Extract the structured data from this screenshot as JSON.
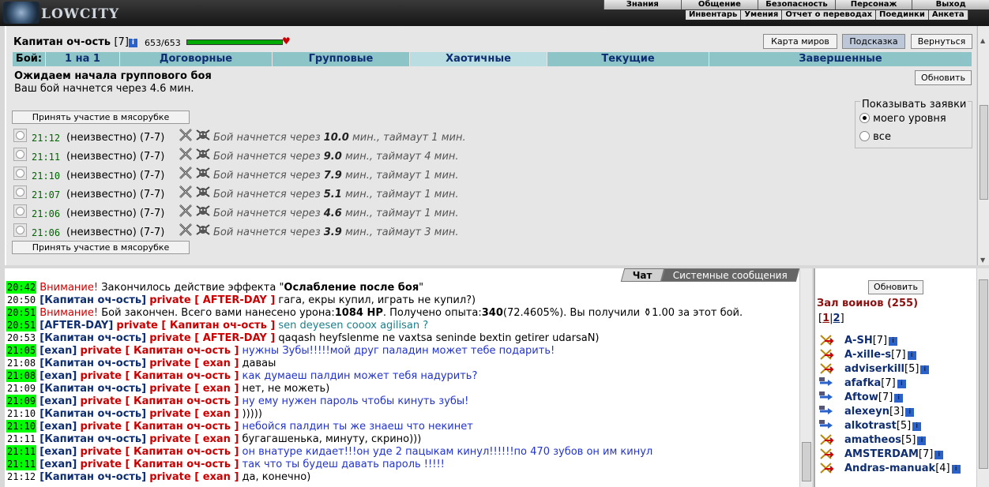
{
  "app": {
    "logo_text": "LOWCITY"
  },
  "topmenu": {
    "row1": [
      "Знания",
      "Общение",
      "Безопасность",
      "Персонаж",
      "Выход"
    ],
    "row2": [
      "Инвентарь",
      "Умения",
      "Отчет о переводах",
      "Поединки",
      "Анкета"
    ]
  },
  "player": {
    "name": "Капитан оч-ость",
    "level": "[7]",
    "hp": "653/653",
    "hp_fraction": 1.0
  },
  "header_buttons": {
    "world_map": "Карта миров",
    "hint": "Подсказка",
    "back": "Вернуться"
  },
  "tabs": {
    "label": "Бой:",
    "items": [
      "1 на 1",
      "Договорные",
      "Групповые",
      "Хаотичные",
      "Текущие",
      "Завершенные"
    ],
    "active": "Хаотичные"
  },
  "status": {
    "title": "Ожидаем начала группового боя",
    "subtitle": "Ваш бой начнется через 4.6 мин.",
    "refresh": "Обновить"
  },
  "show_filter": {
    "label": "Показывать заявки",
    "options": [
      "моего уровня",
      "все"
    ],
    "selected": "моего уровня"
  },
  "join_button": "Принять участие в мясорубке",
  "bids": [
    {
      "time": "21:12",
      "who": "(неизвестно) (7-7)",
      "pre": "Бой начнется через",
      "mins": "10.0",
      "post": "мин., таймаут 1 мин."
    },
    {
      "time": "21:11",
      "who": "(неизвестно) (7-7)",
      "pre": "Бой начнется через",
      "mins": "9.0",
      "post": "мин., таймаут 4 мин."
    },
    {
      "time": "21:10",
      "who": "(неизвестно) (7-7)",
      "pre": "Бой начнется через",
      "mins": "7.9",
      "post": "мин., таймаут 1 мин."
    },
    {
      "time": "21:07",
      "who": "(неизвестно) (7-7)",
      "pre": "Бой начнется через",
      "mins": "5.1",
      "post": "мин., таймаут 1 мин."
    },
    {
      "time": "21:06",
      "who": "(неизвестно) (7-7)",
      "pre": "Бой начнется через",
      "mins": "4.6",
      "post": "мин., таймаут 1 мин."
    },
    {
      "time": "21:06",
      "who": "(неизвестно) (7-7)",
      "pre": "Бой начнется через",
      "mins": "3.9",
      "post": "мин., таймаут 3 мин."
    }
  ],
  "chat_tabs": [
    "Чат",
    "Системные сообщения"
  ],
  "chat": [
    {
      "t": "20:42",
      "hl": true,
      "parts": [
        [
          "warn",
          "Внимание!"
        ],
        [
          "",
          "Закончилось действие эффекта \""
        ],
        [
          "b",
          "Ослабление после боя"
        ],
        [
          "",
          "\""
        ]
      ]
    },
    {
      "t": "20:50",
      "hl": false,
      "parts": [
        [
          "nick",
          "[Капитан оч-ость]"
        ],
        [
          "priv",
          "private [ AFTER-DAY ]"
        ],
        [
          "",
          "гага, екры купил, играть не купил?)"
        ]
      ]
    },
    {
      "t": "20:51",
      "hl": true,
      "parts": [
        [
          "warn",
          "Внимание!"
        ],
        [
          "",
          "Бой закончен. Всего вами нанесено урона:"
        ],
        [
          "b",
          "1084 HP"
        ],
        [
          "",
          ". Получено опыта:"
        ],
        [
          "b",
          "340"
        ],
        [
          "",
          "(72.4605%). Вы получили ⚱1.00 за этот бой."
        ]
      ]
    },
    {
      "t": "20:51",
      "hl": true,
      "parts": [
        [
          "nick",
          "[AFTER-DAY]"
        ],
        [
          "priv",
          "private [ Капитан оч-ость ]"
        ],
        [
          "teal",
          "sen deyesen cooox agilisan ?"
        ]
      ]
    },
    {
      "t": "20:53",
      "hl": false,
      "parts": [
        [
          "nick",
          "[Капитан оч-ость]"
        ],
        [
          "priv",
          "private [ AFTER-DAY ]"
        ],
        [
          "",
          "qaqash heyfslenme ne vaxtsa seninde bextin getirer udarsaN)"
        ]
      ]
    },
    {
      "t": "21:05",
      "hl": true,
      "parts": [
        [
          "nick",
          "[exan]"
        ],
        [
          "priv",
          "private [ Капитан оч-ость ]"
        ],
        [
          "blue",
          "нужны Зубы!!!!!мой друг паладин может тебе подарить!"
        ]
      ]
    },
    {
      "t": "21:08",
      "hl": false,
      "parts": [
        [
          "nick",
          "[Капитан оч-ость]"
        ],
        [
          "priv",
          "private [ exan ]"
        ],
        [
          "",
          "даваы"
        ]
      ]
    },
    {
      "t": "21:08",
      "hl": true,
      "parts": [
        [
          "nick",
          "[exan]"
        ],
        [
          "priv",
          "private [ Капитан оч-ость ]"
        ],
        [
          "blue",
          "как думаеш палдин может тебя надурить?"
        ]
      ]
    },
    {
      "t": "21:09",
      "hl": false,
      "parts": [
        [
          "nick",
          "[Капитан оч-ость]"
        ],
        [
          "priv",
          "private [ exan ]"
        ],
        [
          "",
          "нет, не можеть)"
        ]
      ]
    },
    {
      "t": "21:09",
      "hl": true,
      "parts": [
        [
          "nick",
          "[exan]"
        ],
        [
          "priv",
          "private [ Капитан оч-ость ]"
        ],
        [
          "blue",
          "ну ему нужен пароль чтобы кинуть зубы!"
        ]
      ]
    },
    {
      "t": "21:10",
      "hl": false,
      "parts": [
        [
          "nick",
          "[Капитан оч-ость]"
        ],
        [
          "priv",
          "private [ exan ]"
        ],
        [
          "",
          "))))) "
        ]
      ]
    },
    {
      "t": "21:10",
      "hl": true,
      "parts": [
        [
          "nick",
          "[exan]"
        ],
        [
          "priv",
          "private [ Капитан оч-ость ]"
        ],
        [
          "blue",
          "небойся палдин ты же знаеш что некинет"
        ]
      ]
    },
    {
      "t": "21:11",
      "hl": false,
      "parts": [
        [
          "nick",
          "[Капитан оч-ость]"
        ],
        [
          "priv",
          "private [ exan ]"
        ],
        [
          "",
          "бугагашенька, минуту, скрино)))"
        ]
      ]
    },
    {
      "t": "21:11",
      "hl": true,
      "parts": [
        [
          "nick",
          "[exan]"
        ],
        [
          "priv",
          "private [ Капитан оч-ость ]"
        ],
        [
          "blue",
          "он внатуре кидает!!!он уде 2 пацыкам кинул!!!!!!по 470 зубов он им кинул"
        ]
      ]
    },
    {
      "t": "21:11",
      "hl": true,
      "parts": [
        [
          "nick",
          "[exan]"
        ],
        [
          "priv",
          "private [ Капитан оч-ость ]"
        ],
        [
          "blue",
          "так что ты будеш давать пароль !!!!!"
        ]
      ]
    },
    {
      "t": "21:12",
      "hl": false,
      "parts": [
        [
          "nick",
          "[Капитан оч-ость]"
        ],
        [
          "priv",
          "private [ exan ]"
        ],
        [
          "",
          "да, конечно)"
        ]
      ]
    }
  ],
  "sidebar": {
    "refresh": "Обновить",
    "title": "Зал воинов (255)",
    "pages": [
      "1",
      "2"
    ],
    "users": [
      {
        "name": "A-SH",
        "lvl": "[7]",
        "icon": "swords"
      },
      {
        "name": "A-xille-s",
        "lvl": "[7]",
        "icon": "swords"
      },
      {
        "name": "adviserkill",
        "lvl": "[5]",
        "icon": "swords"
      },
      {
        "name": "afafka",
        "lvl": "[7]",
        "icon": "arrow"
      },
      {
        "name": "Aftow",
        "lvl": "[7]",
        "icon": "arrow"
      },
      {
        "name": "alexeyn",
        "lvl": "[3]",
        "icon": "arrow"
      },
      {
        "name": "alkotrast",
        "lvl": "[5]",
        "icon": "arrow"
      },
      {
        "name": "amatheos",
        "lvl": "[5]",
        "icon": "swords"
      },
      {
        "name": "AMSTERDAM",
        "lvl": "[7]",
        "icon": "swords"
      },
      {
        "name": "Andras-manuak",
        "lvl": "[4]",
        "icon": "swords"
      }
    ]
  },
  "colors": {
    "tab_bg": "#8cc4c8",
    "nick": "#0f2e72",
    "private": "#cc0000",
    "highlight": "#00ff00",
    "hp_bar": "#00aa00"
  }
}
